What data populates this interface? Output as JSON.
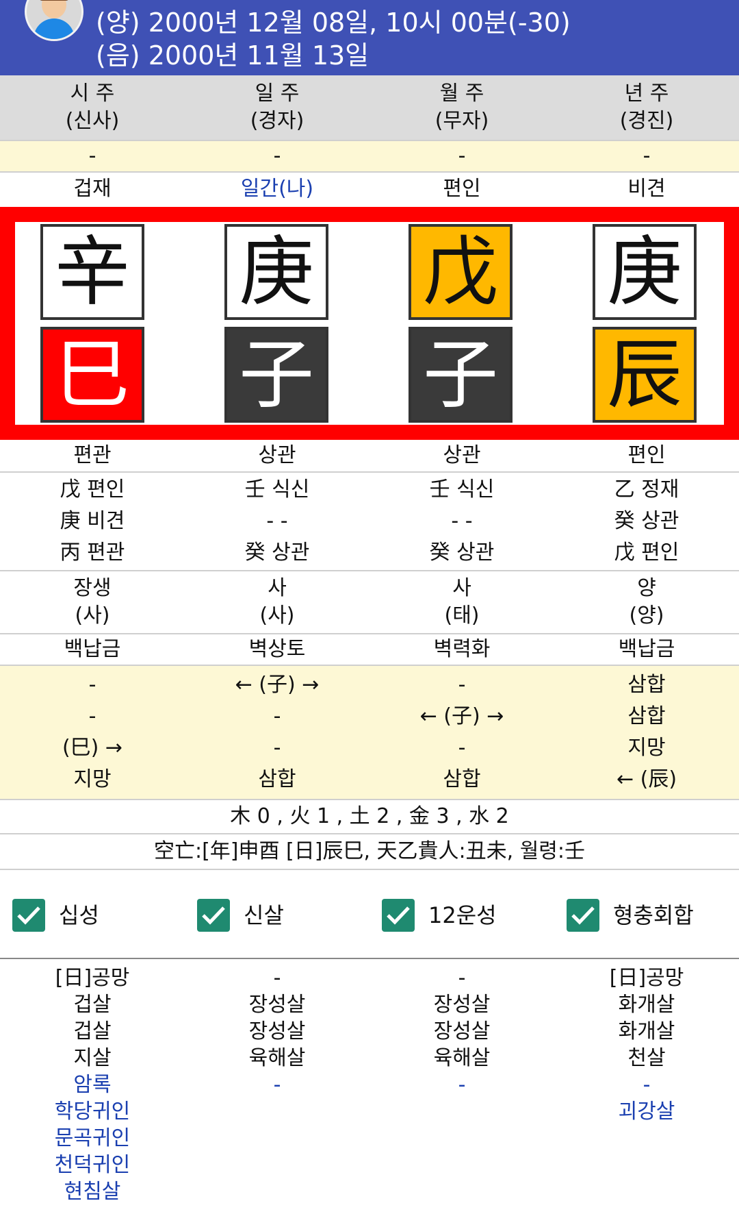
{
  "header": {
    "solar": "(양) 2000년 12월 08일, 10시 00분(-30)",
    "lunar": "(음) 2000년 11월 13일"
  },
  "pillar_titles": [
    {
      "name": "시 주",
      "sub": "(신사)"
    },
    {
      "name": "일 주",
      "sub": "(경자)"
    },
    {
      "name": "월 주",
      "sub": "(무자)"
    },
    {
      "name": "년 주",
      "sub": "(경진)"
    }
  ],
  "yellow_row": [
    "-",
    "-",
    "-",
    "-"
  ],
  "stem_gods": [
    "겁재",
    "일간(나)",
    "편인",
    "비견"
  ],
  "stems": [
    {
      "char": "辛",
      "bg": "#ffffff",
      "fg": "#111111"
    },
    {
      "char": "庚",
      "bg": "#ffffff",
      "fg": "#111111"
    },
    {
      "char": "戊",
      "bg": "#ffb800",
      "fg": "#111111"
    },
    {
      "char": "庚",
      "bg": "#ffffff",
      "fg": "#111111"
    }
  ],
  "branches": [
    {
      "char": "巳",
      "bg": "#ff0000",
      "fg": "#ffffff"
    },
    {
      "char": "子",
      "bg": "#3a3a3a",
      "fg": "#ffffff"
    },
    {
      "char": "子",
      "bg": "#3a3a3a",
      "fg": "#ffffff"
    },
    {
      "char": "辰",
      "bg": "#ffb800",
      "fg": "#111111"
    }
  ],
  "branch_gods": [
    "편관",
    "상관",
    "상관",
    "편인"
  ],
  "hidden_stems": [
    [
      "戊 편인",
      "庚 비견",
      "丙 편관"
    ],
    [
      "壬 식신",
      "- -",
      "癸 상관"
    ],
    [
      "壬 식신",
      "- -",
      "癸 상관"
    ],
    [
      "乙 정재",
      "癸 상관",
      "戊 편인"
    ]
  ],
  "twelve_stages": [
    {
      "main": "장생",
      "sub": "(사)"
    },
    {
      "main": "사",
      "sub": "(사)"
    },
    {
      "main": "사",
      "sub": "(태)"
    },
    {
      "main": "양",
      "sub": "(양)"
    }
  ],
  "nayin": [
    "백납금",
    "벽상토",
    "벽력화",
    "백납금"
  ],
  "relations": [
    [
      "-",
      "-",
      "(巳) →",
      "지망"
    ],
    [
      "← (子) →",
      "-",
      "-",
      "삼합"
    ],
    [
      "-",
      "← (子) →",
      "-",
      "삼합"
    ],
    [
      "삼합",
      "삼합",
      "지망",
      "← (辰)"
    ]
  ],
  "elements_summary": "木 0 , 火 1 , 土 2 , 金 3 , 水 2",
  "extra_summary": "空亡:[年]申酉 [日]辰巳, 天乙貴人:丑未, 월령:壬",
  "toggles": [
    {
      "label": "십성",
      "checked": true
    },
    {
      "label": "신살",
      "checked": true
    },
    {
      "label": "12운성",
      "checked": true
    },
    {
      "label": "형충회합",
      "checked": true
    }
  ],
  "sinsal": [
    {
      "black": [
        "[日]공망",
        "겁살",
        "겁살",
        "지살"
      ],
      "blue": [
        "암록",
        "학당귀인",
        "문곡귀인",
        "천덕귀인",
        "현침살"
      ]
    },
    {
      "black": [
        "-",
        "장성살",
        "장성살",
        "육해살"
      ],
      "blue": [
        "-"
      ]
    },
    {
      "black": [
        "-",
        "장성살",
        "장성살",
        "육해살"
      ],
      "blue": [
        "-"
      ]
    },
    {
      "black": [
        "[日]공망",
        "화개살",
        "화개살",
        "천살"
      ],
      "blue": [
        "-",
        "괴강살"
      ]
    }
  ]
}
